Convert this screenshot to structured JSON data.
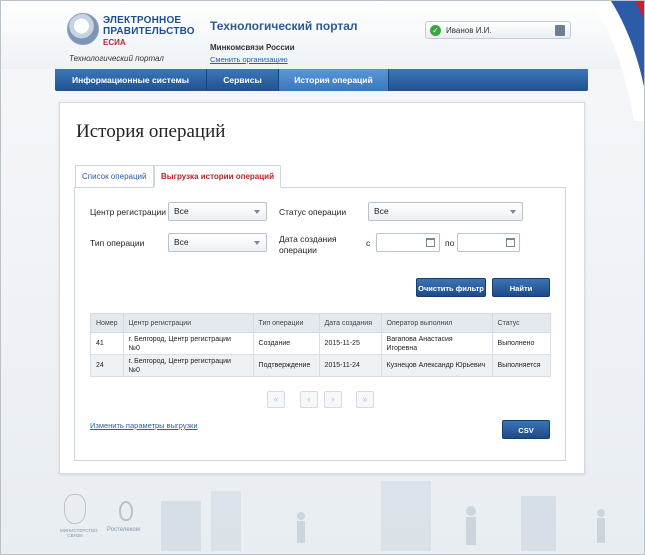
{
  "header": {
    "logo_line1": "ЭЛЕКТРОННОЕ",
    "logo_line2": "ПРАВИТЕЛЬСТВО",
    "logo_line3": "ЕСИА",
    "logo_sub": "Технологический портал",
    "portal_title": "Технологический портал",
    "ministry": "Минкомсвязи России",
    "change_org": "Сменить организацию",
    "user_name": "Иванов И.И.",
    "flag_colors": [
      "#ffffff",
      "#2d5ba8",
      "#c8202f"
    ]
  },
  "nav": {
    "items": [
      {
        "label": "Информационные системы",
        "active": false
      },
      {
        "label": "Сервисы",
        "active": false
      },
      {
        "label": "История операций",
        "active": true
      }
    ]
  },
  "page": {
    "title": "История операций",
    "tabs": [
      {
        "label": "Список операций",
        "active": false
      },
      {
        "label": "Выгрузка истории операций",
        "active": true
      }
    ]
  },
  "filters": {
    "center_label": "Центр регистрации",
    "center_value": "Все",
    "status_label": "Статус операции",
    "status_value": "Все",
    "type_label": "Тип операции",
    "type_value": "Все",
    "date_label_1": "Дата создания",
    "date_label_2": "операции",
    "from_label": "с",
    "to_label": "по",
    "from_value": "",
    "to_value": "",
    "clear_button": "Очистить фильтр",
    "find_button": "Найти"
  },
  "table": {
    "headers": [
      "Номер",
      "Центр регистрации",
      "Тип операции",
      "Дата создания",
      "Оператор выполнил",
      "Статус"
    ],
    "rows": [
      {
        "num": "41",
        "center_1": "г. Белгород, Центр регистрации",
        "center_2": "№0",
        "type": "Создание",
        "date": "2015-11-25",
        "op_1": "Вагапова Анастасия",
        "op_2": "Игоревна",
        "status": "Выполнено"
      },
      {
        "num": "24",
        "center_1": "г. Белгород, Центр регистрации",
        "center_2": "№0",
        "type": "Подтверждение",
        "date": "2015-11-24",
        "op_1": "Кузнецов Александр Юрьевич",
        "op_2": "",
        "status": "Выполняется"
      }
    ]
  },
  "pager": {
    "first": "«",
    "prev": "‹",
    "next": "›",
    "last": "»"
  },
  "bottom": {
    "change_params": "Изменить параметры выгрузки",
    "csv_button": "CSV"
  },
  "footer": {
    "ministry": "МИНИСТЕРСТВО СВЯЗИ",
    "rostelecom": "Ростелеком"
  },
  "colors": {
    "nav_blue": "#1f528f",
    "nav_active": "#3a77bd",
    "link": "#2c5d9e",
    "tab_active_text": "#b3262d",
    "button": "#1d4b86",
    "status_ok": "#3ea33e"
  }
}
